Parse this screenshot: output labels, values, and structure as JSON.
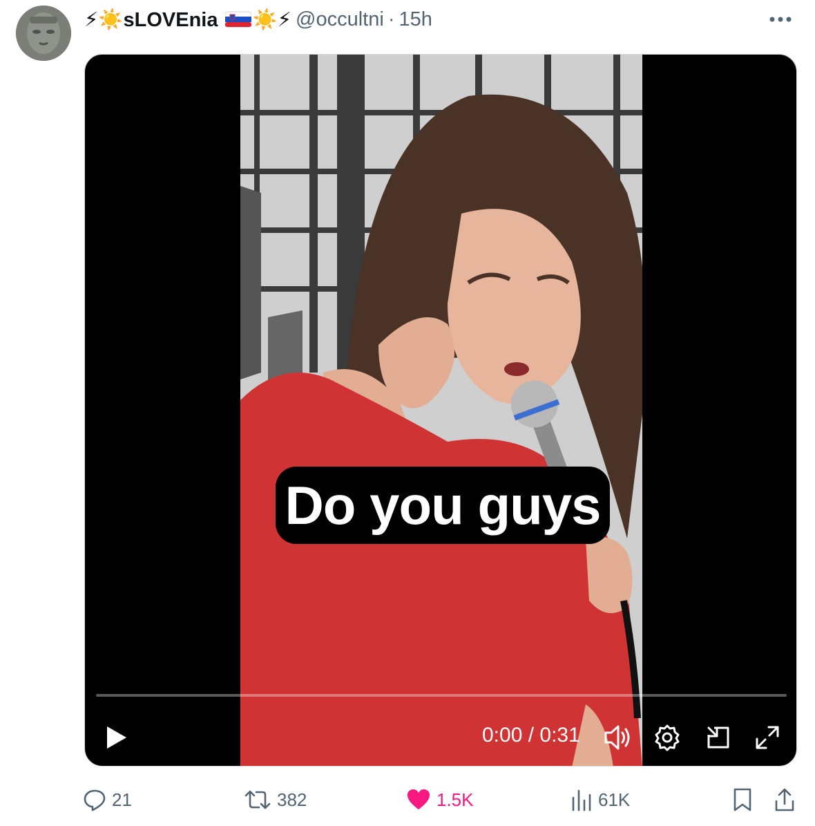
{
  "post": {
    "author": {
      "display_name": "⚡☀️sLOVEnia 🇸🇮☀️⚡",
      "name_prefix": "⚡☀️",
      "name_text": "sLOVEnia",
      "name_suffix": "☀️⚡",
      "handle": "@occultni",
      "separator": "·",
      "time": "15h"
    },
    "video": {
      "caption": "Do you guys",
      "timecode": "0:00 / 0:31",
      "progress": 0
    },
    "actions": {
      "replies": "21",
      "reposts": "382",
      "likes": "1.5K",
      "views": "61K"
    }
  },
  "icons": [
    "more-icon",
    "play-icon",
    "volume-icon",
    "settings-icon",
    "pip-icon",
    "fullscreen-icon",
    "reply-icon",
    "repost-icon",
    "like-icon",
    "views-icon",
    "bookmark-icon",
    "share-icon"
  ],
  "colors": {
    "like": "#f91880",
    "muted": "#536471",
    "accent": "#1d9bf0"
  }
}
